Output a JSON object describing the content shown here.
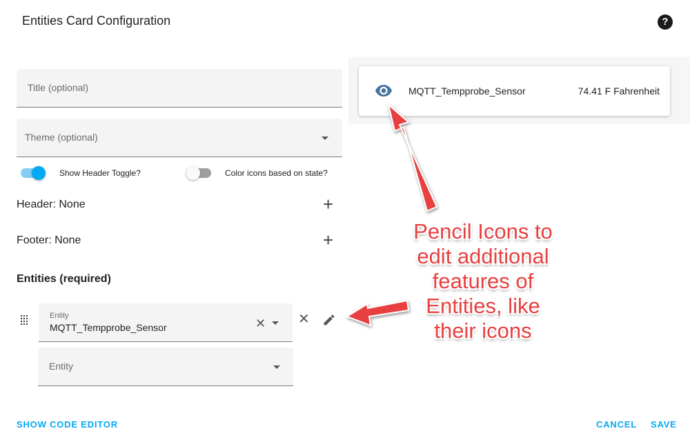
{
  "dialog": {
    "title": "Entities Card Configuration",
    "help_icon": "help-circle-icon"
  },
  "form": {
    "title_placeholder": "Title (optional)",
    "theme_placeholder": "Theme (optional)",
    "show_header_toggle_label": "Show Header Toggle?",
    "show_header_toggle_on": true,
    "color_icons_label": "Color icons based on state?",
    "color_icons_on": false,
    "header_label": "Header: None",
    "footer_label": "Footer: None",
    "entities_title": "Entities (required)",
    "entity_rows": [
      {
        "label": "Entity",
        "value": "MQTT_Tempprobe_Sensor"
      },
      {
        "label": "Entity",
        "value": ""
      }
    ]
  },
  "preview": {
    "icon": "eye-icon",
    "entity_name": "MQTT_Tempprobe_Sensor",
    "entity_state": "74.41 F Fahrenheit"
  },
  "annotation": {
    "lines": [
      "Pencil Icons to",
      "edit additional",
      "features of",
      "Entities, like",
      "their icons"
    ],
    "color": "#e84040"
  },
  "actions": {
    "show_code_editor": "SHOW CODE EDITOR",
    "cancel": "CANCEL",
    "save": "SAVE"
  },
  "colors": {
    "accent": "#03a9f4",
    "eye_icon": "#44739e"
  }
}
